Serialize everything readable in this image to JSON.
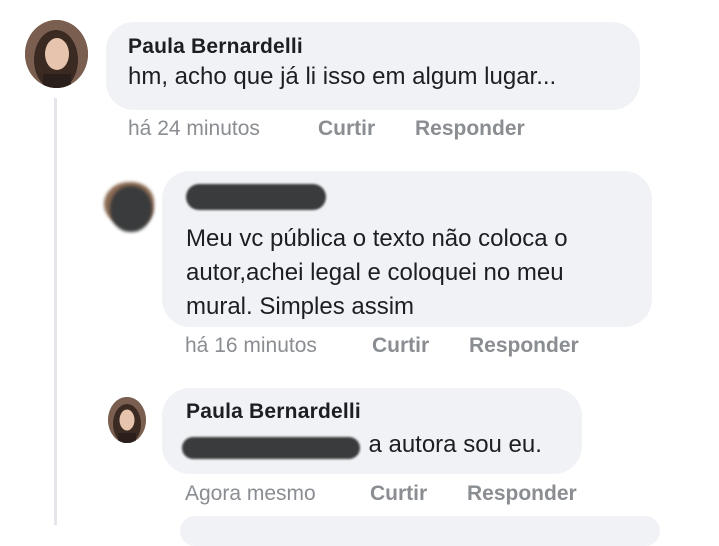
{
  "comments": [
    {
      "author": "Paula Bernardelli",
      "text": "hm, acho que já li isso em algum lugar...",
      "time": "há 24 minutos",
      "like": "Curtir",
      "reply": "Responder",
      "avatar": "profile-photo-woman"
    },
    {
      "author": "",
      "lines": [
        "Meu vc pública o texto não coloca o",
        "autor,achei legal e coloquei no meu",
        "mural. Simples assim"
      ],
      "time": "há 16 minutos",
      "like": "Curtir",
      "reply": "Responder",
      "avatar": "redacted-avatar"
    },
    {
      "author": "Paula Bernardelli",
      "text": "a autora sou eu.",
      "time": "Agora mesmo",
      "like": "Curtir",
      "reply": "Responder",
      "avatar": "profile-photo-woman"
    }
  ],
  "colors": {
    "bubble": "#f0f2f5",
    "meta_text": "#8a8d91",
    "redaction": "#3a3b3c"
  }
}
